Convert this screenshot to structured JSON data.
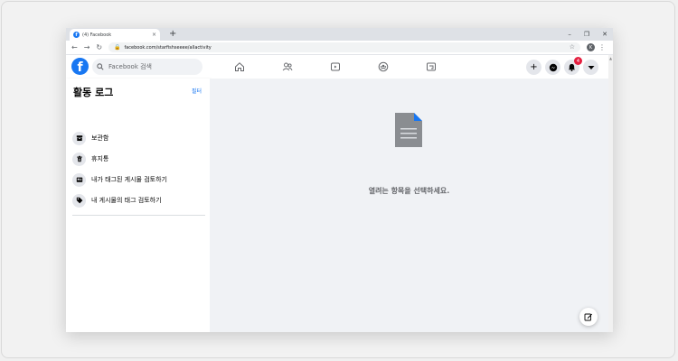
{
  "browser": {
    "tab_title": "(4) Facebook",
    "tab_close": "×",
    "new_tab": "+",
    "controls": [
      "–",
      "❐",
      "✕"
    ],
    "url": "facebook.com/starfishseeee/allactivity",
    "profile_initial": "K"
  },
  "fb_header": {
    "logo": "f",
    "search_placeholder": "Facebook 검색",
    "nav": [
      "home-icon",
      "friends-icon",
      "watch-icon",
      "groups-icon",
      "gaming-icon"
    ],
    "notification_count": "4"
  },
  "sidebar": {
    "title": "활동 로그",
    "filter": "필터",
    "items": [
      {
        "label": "보관함",
        "icon": "archive-icon"
      },
      {
        "label": "휴지통",
        "icon": "trash-icon"
      },
      {
        "label": "내가 태그된 게시물 검토하기",
        "icon": "tag-review-icon"
      },
      {
        "label": "내 게시물의 태그 검토하기",
        "icon": "tag-icon"
      }
    ]
  },
  "main": {
    "empty_message": "열려는 항목을 선택하세요."
  },
  "colors": {
    "brand": "#1877f2",
    "badge": "#e41e3f",
    "main_bg": "#f0f2f5"
  }
}
